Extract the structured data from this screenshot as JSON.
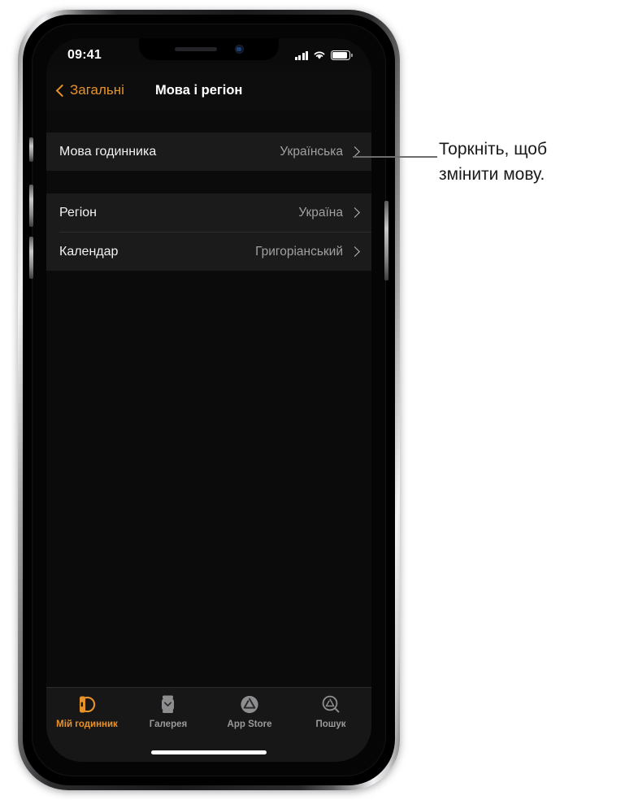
{
  "status_bar": {
    "time": "09:41",
    "signal_icon": "cellular-signal-icon",
    "wifi_icon": "wifi-icon",
    "battery_icon": "battery-full-icon"
  },
  "nav": {
    "back_label": "Загальні",
    "back_icon": "chevron-left-icon",
    "title": "Мова і регіон"
  },
  "groups": [
    {
      "rows": [
        {
          "label": "Мова годинника",
          "value": "Українська",
          "chevron": "chevron-right-icon"
        }
      ]
    },
    {
      "rows": [
        {
          "label": "Регіон",
          "value": "Україна",
          "chevron": "chevron-right-icon"
        },
        {
          "label": "Календар",
          "value": "Григоріанський",
          "chevron": "chevron-right-icon"
        }
      ]
    }
  ],
  "tabs": [
    {
      "label": "Мій годинник",
      "icon": "watch-icon",
      "active": true
    },
    {
      "label": "Галерея",
      "icon": "watch-face-gallery-icon",
      "active": false
    },
    {
      "label": "App Store",
      "icon": "app-store-icon",
      "active": false
    },
    {
      "label": "Пошук",
      "icon": "search-app-store-icon",
      "active": false
    }
  ],
  "callout": {
    "line1": "Торкніть, щоб",
    "line2": "змінити мову."
  },
  "colors": {
    "accent": "#e8922a",
    "screen_background": "#0b0b0b",
    "row_background": "#1b1b1b",
    "value_text": "#a0a0a3",
    "callout_text": "#1a1a1a"
  }
}
